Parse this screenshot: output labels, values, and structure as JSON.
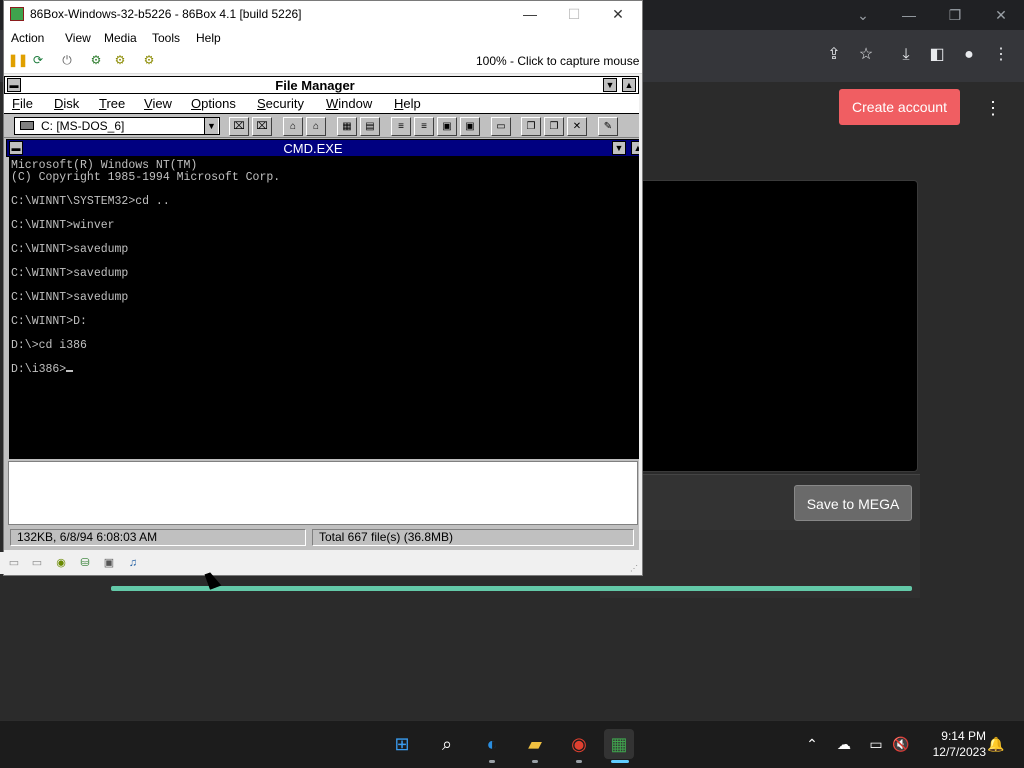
{
  "host_window": {
    "title": "86Box-Windows-32-b5226 - 86Box 4.1 [build 5226]",
    "menu": [
      "Action",
      "View",
      "Media",
      "Tools",
      "Help"
    ],
    "capture_hint": "100% - Click to capture mouse"
  },
  "file_manager": {
    "title": "File Manager",
    "menu": [
      {
        "first": "F",
        "rest": "ile"
      },
      {
        "first": "D",
        "rest": "isk"
      },
      {
        "first": "T",
        "rest": "ree"
      },
      {
        "first": "V",
        "rest": "iew"
      },
      {
        "first": "O",
        "rest": "ptions"
      },
      {
        "first": "S",
        "rest": "ecurity"
      },
      {
        "first": "W",
        "rest": "indow"
      },
      {
        "first": "H",
        "rest": "elp"
      }
    ],
    "drive": "C: [MS-DOS_6]",
    "status_left": "132KB, 6/8/94 6:08:03 AM",
    "status_right": "Total 667 file(s) (36.8MB)"
  },
  "cmd": {
    "title": "CMD.EXE",
    "lines": [
      "Microsoft(R) Windows NT(TM)",
      "(C) Copyright 1985-1994 Microsoft Corp.",
      "",
      "C:\\WINNT\\SYSTEM32>cd ..",
      "",
      "C:\\WINNT>winver",
      "",
      "C:\\WINNT>savedump",
      "",
      "C:\\WINNT>savedump",
      "",
      "C:\\WINNT>savedump",
      "",
      "C:\\WINNT>D:",
      "",
      "D:\\>cd i386",
      "",
      "D:\\i386>"
    ]
  },
  "browser": {
    "create_account": "Create account",
    "save_to_mega": "Save to MEGA",
    "progress_fraction": 1.0,
    "accent_color": "#f05e62",
    "progress_color": "#63c9a8"
  },
  "taskbar": {
    "time": "9:14 PM",
    "date": "12/7/2023",
    "apps": [
      "windows-start-icon",
      "search-icon",
      "edge-beta-icon",
      "file-explorer-icon",
      "chrome-icon",
      "86box-icon"
    ]
  }
}
